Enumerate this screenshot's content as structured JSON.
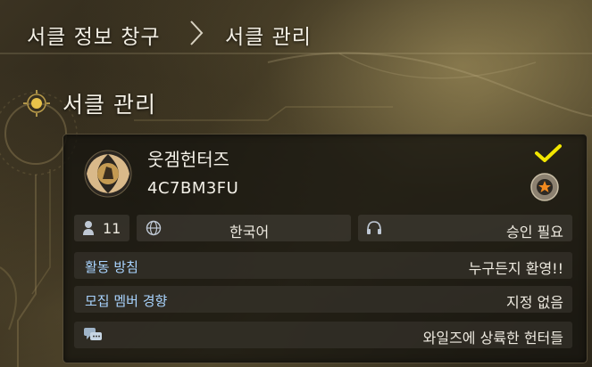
{
  "breadcrumb": {
    "items": [
      "서클 정보 창구",
      "서클 관리"
    ],
    "separator_icon": "chevron-right-icon"
  },
  "section": {
    "title": "서클 관리",
    "icon": "compass-sun-icon"
  },
  "circle": {
    "name": "웃겜헌터즈",
    "id": "4C7BM3FU",
    "emblem_icon": "circle-emblem-icon",
    "status_icon": "checkmark-icon",
    "badge_icon": "star-badge-icon",
    "check_color": "#f2e600"
  },
  "stats": {
    "member_count": "11",
    "member_icon": "member-icon",
    "language": "한국어",
    "language_icon": "globe-icon",
    "join_policy": "승인 필요",
    "join_icon": "headset-icon"
  },
  "details": [
    {
      "label": "활동 방침",
      "value": "누구든지 환영!!"
    },
    {
      "label": "모집 멤버 경향",
      "value": "지정 없음"
    }
  ],
  "message": {
    "icon": "chat-bubbles-icon",
    "text": "와일즈에 상륙한 헌터들"
  },
  "colors": {
    "label_blue": "#a9d4ff",
    "text": "#eeeae0"
  }
}
